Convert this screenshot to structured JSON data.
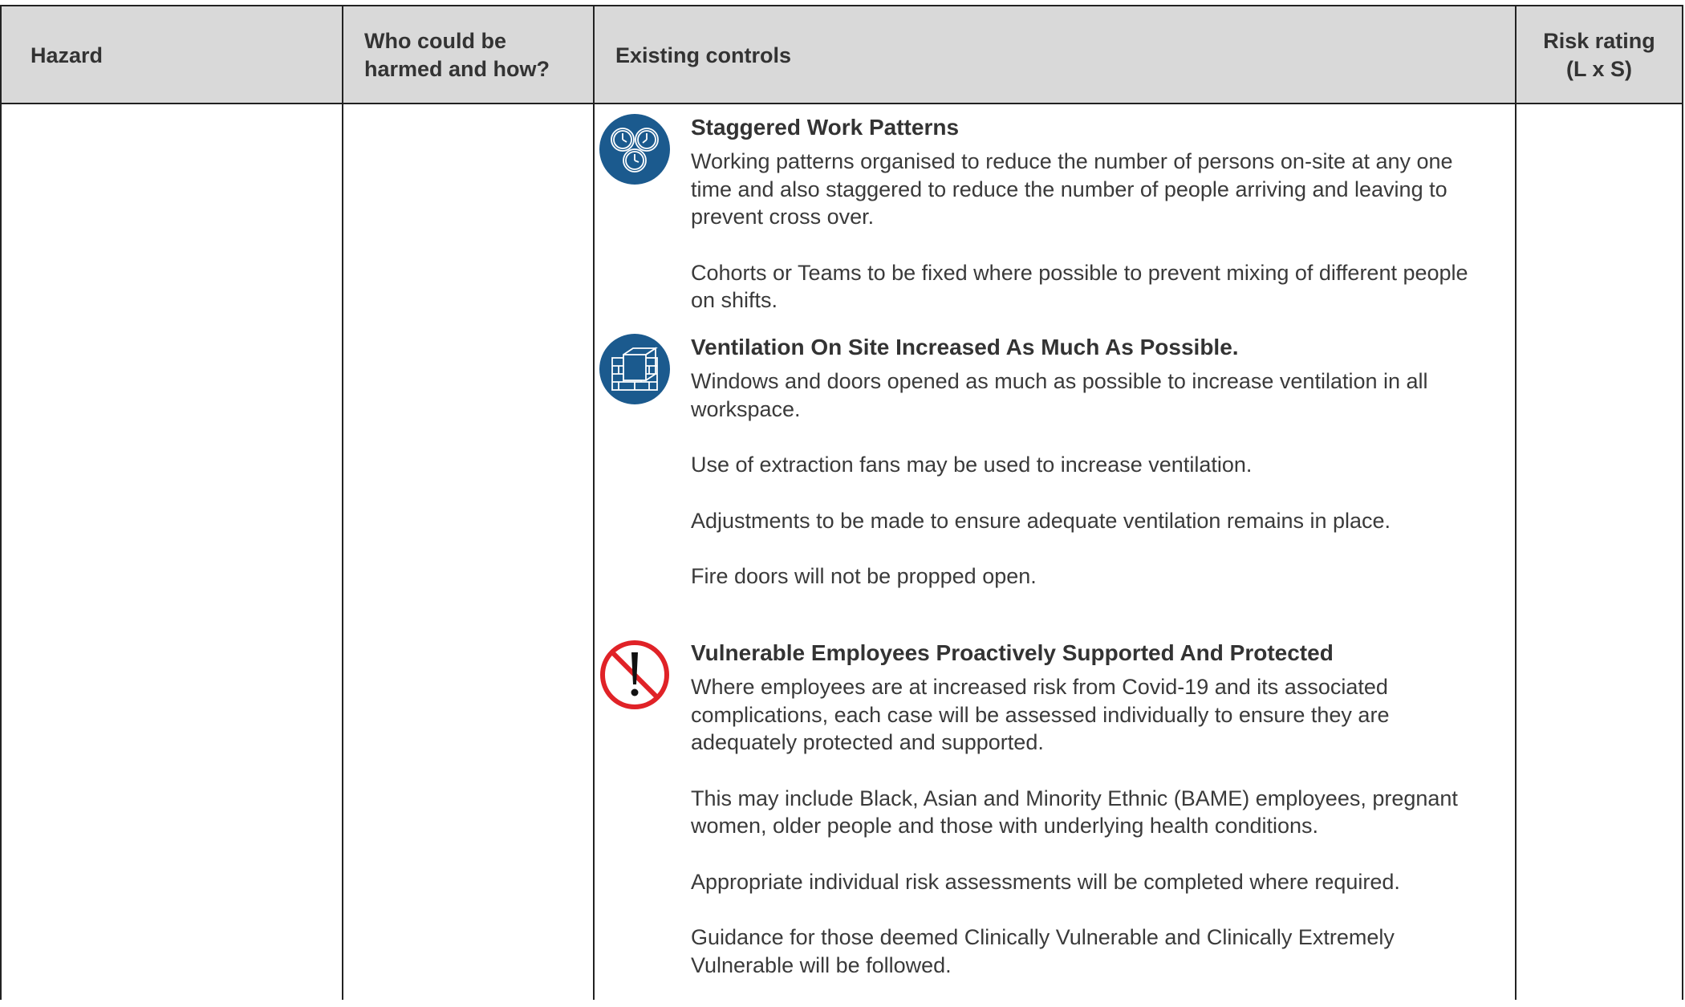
{
  "table": {
    "headers": {
      "hazard": "Hazard",
      "who_harmed_line1": "Who could be",
      "who_harmed_line2": "harmed and how?",
      "existing_controls": "Existing controls",
      "risk_rating_line1": "Risk rating",
      "risk_rating_line2": "(L x S)"
    }
  },
  "controls": [
    {
      "icon": "clocks-icon",
      "title": "Staggered Work Patterns",
      "paragraphs": [
        "Working patterns organised to reduce the number of persons on-site at any one time and also staggered to reduce the number of people arriving and leaving to prevent cross over.",
        "Cohorts or Teams to be fixed where possible to prevent mixing of different people on shifts."
      ]
    },
    {
      "icon": "window-ventilation-icon",
      "title": "Ventilation On Site Increased As Much As Possible.",
      "paragraphs": [
        "Windows and doors opened as much as possible to increase ventilation in all workspace.",
        "Use of extraction fans may be used to increase ventilation.",
        "Adjustments to be made to ensure adequate ventilation remains in place.",
        "Fire doors will not be propped open."
      ]
    },
    {
      "icon": "prohibited-exclamation-icon",
      "title": "Vulnerable Employees Proactively Supported And Protected",
      "paragraphs": [
        "Where employees are at increased risk from Covid-19 and its associated complications, each case will be assessed individually to ensure they are adequately protected and supported.",
        "This may include Black, Asian and Minority Ethnic (BAME) employees, pregnant women, older people and those with underlying health conditions.",
        "Appropriate individual risk assessments will be completed where required.",
        "Guidance for those deemed Clinically Vulnerable and Clinically Extremely Vulnerable will be followed."
      ]
    }
  ],
  "colors": {
    "header_bg": "#d9d9d9",
    "icon_blue": "#1b5a8e",
    "prohibition_red": "#e02227",
    "border": "#222222"
  }
}
